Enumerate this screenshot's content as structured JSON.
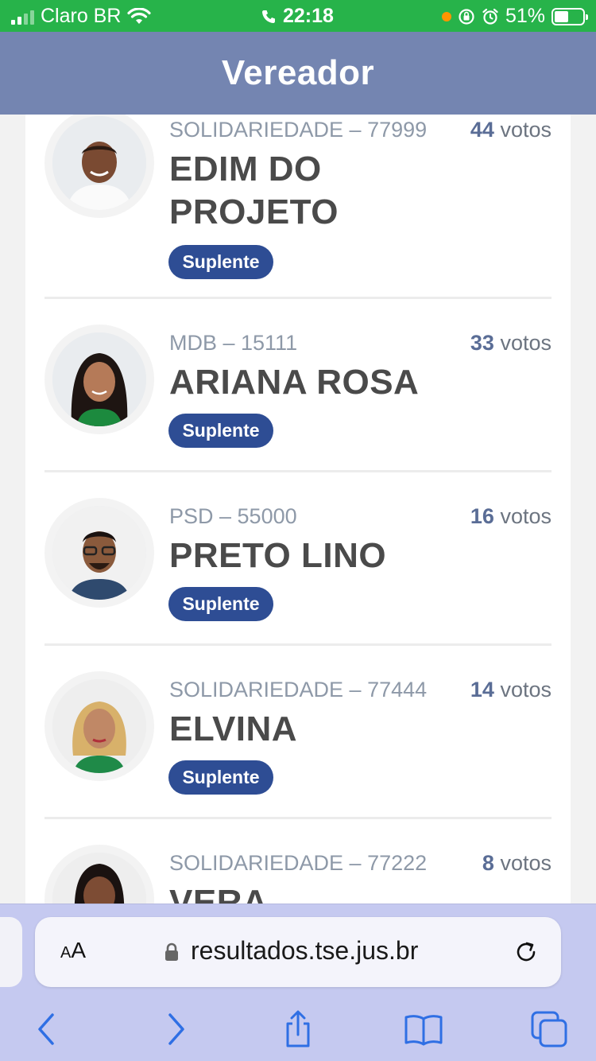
{
  "status_bar": {
    "carrier": "Claro BR",
    "time": "22:18",
    "battery": "51%",
    "battery_level": 0.51
  },
  "header": {
    "title": "Vereador"
  },
  "candidates": [
    {
      "party": "SOLIDARIEDADE – 77999",
      "votes_num": "44",
      "votes_label": "votos",
      "name": "EDIM DO PROJETO",
      "status": "Suplente"
    },
    {
      "party": "MDB – 15111",
      "votes_num": "33",
      "votes_label": "votos",
      "name": "ARIANA ROSA",
      "status": "Suplente"
    },
    {
      "party": "PSD – 55000",
      "votes_num": "16",
      "votes_label": "votos",
      "name": "PRETO LINO",
      "status": "Suplente"
    },
    {
      "party": "SOLIDARIEDADE – 77444",
      "votes_num": "14",
      "votes_label": "votos",
      "name": "ELVINA",
      "status": "Suplente"
    },
    {
      "party": "SOLIDARIEDADE – 77222",
      "votes_num": "8",
      "votes_label": "votos",
      "name": "VERA"
    }
  ],
  "browser": {
    "text_size_label_small": "A",
    "text_size_label_big": "A",
    "url": "resultados.tse.jus.br"
  },
  "colors": {
    "status_bar": "#27b34a",
    "header": "#7485b1",
    "badge": "#2e4d94",
    "toolbar_icon": "#2f6fe4"
  }
}
